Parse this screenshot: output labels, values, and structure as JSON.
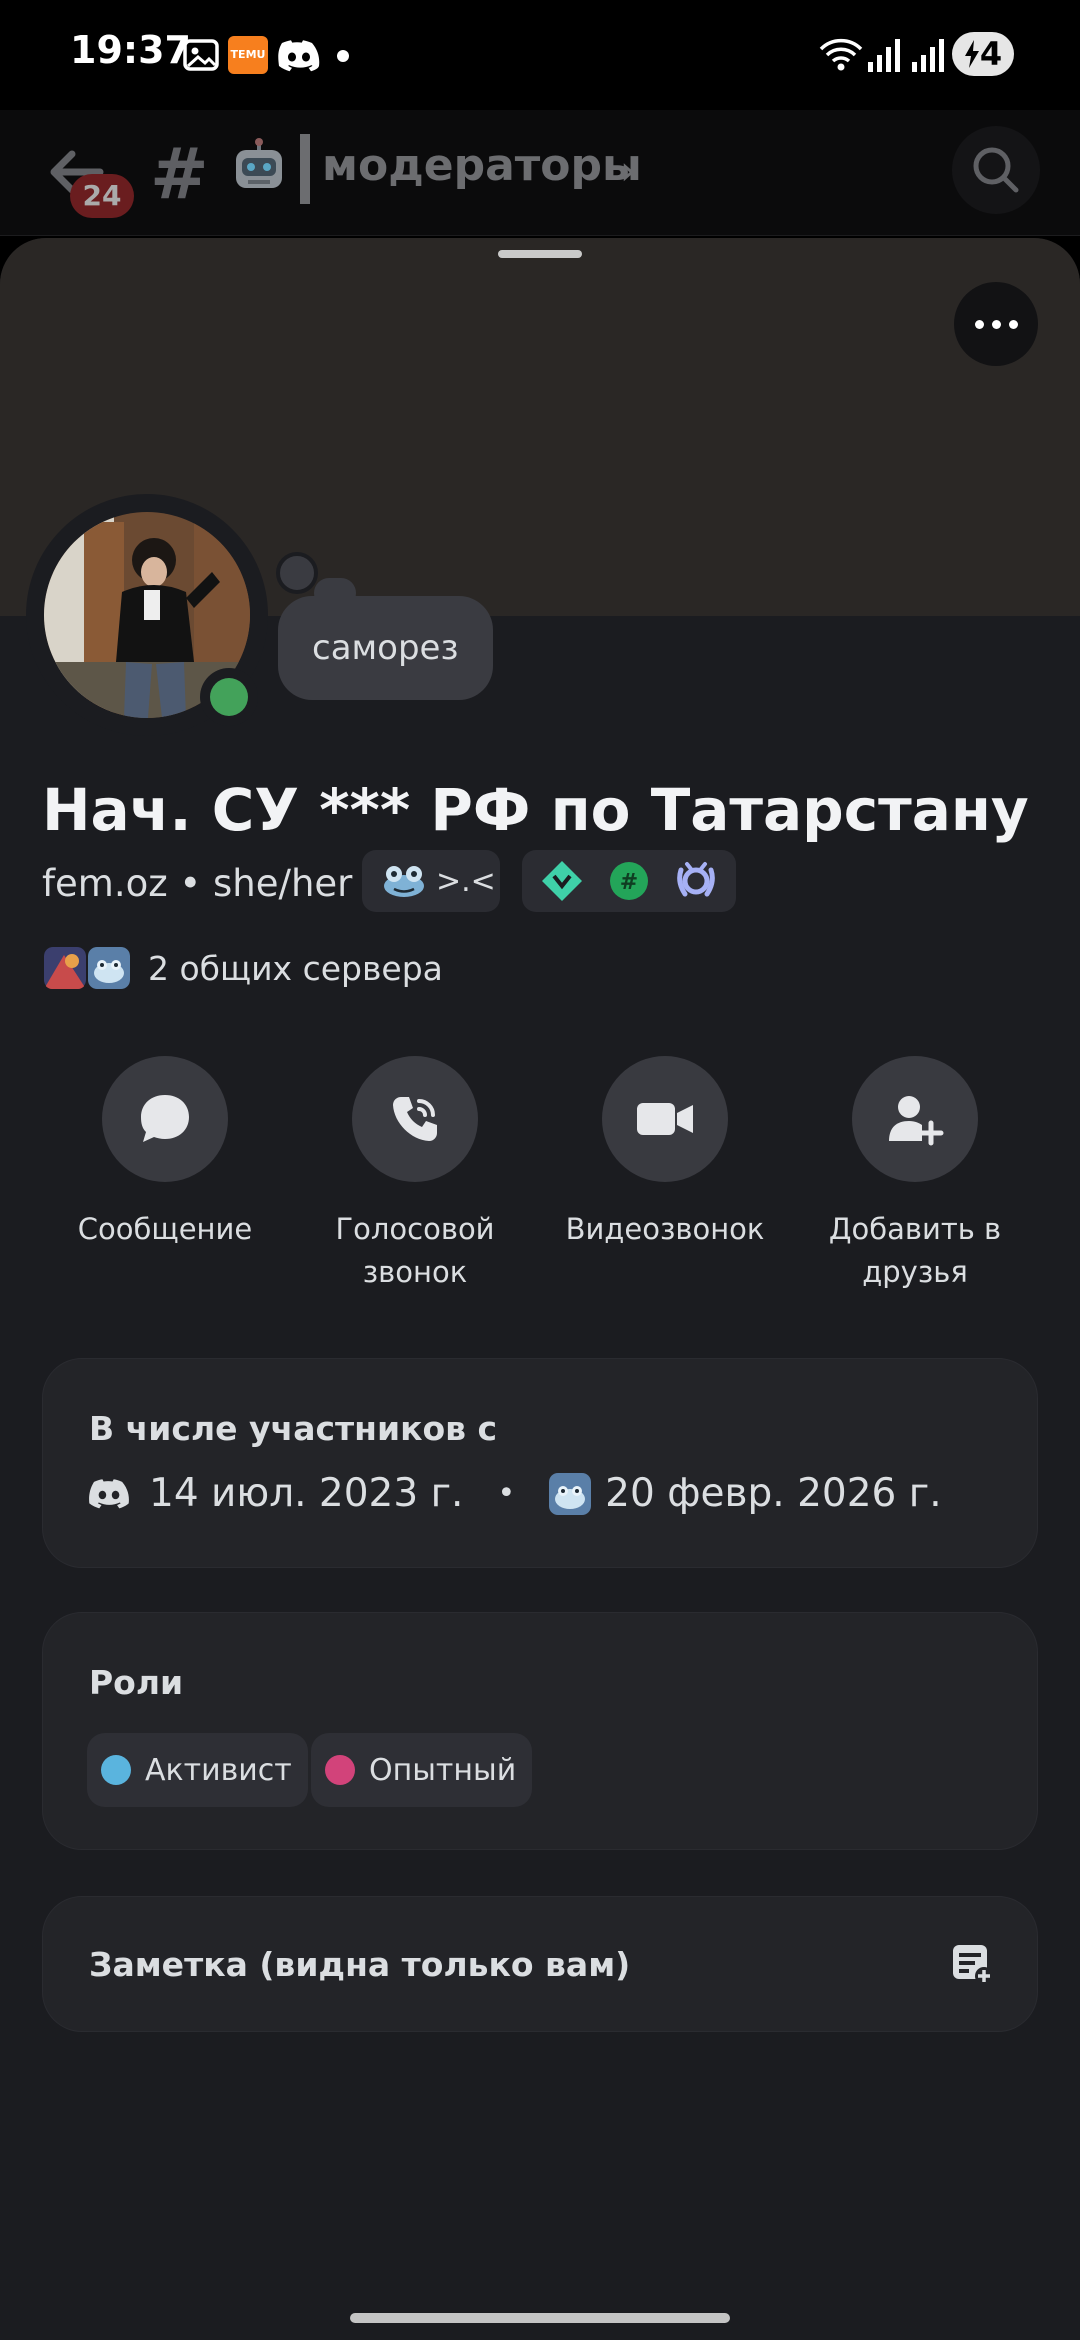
{
  "status_bar": {
    "time": "19:37",
    "temu_label": "TEMU",
    "battery": "4"
  },
  "channel_header": {
    "unread_badge": "24",
    "channel_name": "модераторы"
  },
  "profile": {
    "thought_bubble": "саморез",
    "display_name": "Нач. СУ *** РФ по Татарстану",
    "username": "fem.oz",
    "separator": "•",
    "pronouns": "she/her",
    "tag_text": ">.<",
    "mutual_servers": "2 общих сервера"
  },
  "actions": [
    {
      "label": "Сообщение",
      "icon": "chat-bubble-icon"
    },
    {
      "label": "Голосовой звонок",
      "icon": "phone-call-icon"
    },
    {
      "label": "Видеозвонок",
      "icon": "video-camera-icon"
    },
    {
      "label": "Добавить в друзья",
      "icon": "add-friend-icon"
    }
  ],
  "member_since": {
    "title": "В числе участников с",
    "discord_date": "14 июл. 2023 г.",
    "separator": "•",
    "server_date": "20 февр. 2026 г."
  },
  "roles": {
    "title": "Роли",
    "items": [
      {
        "name": "Активист",
        "color": "#5ab4de"
      },
      {
        "name": "Опытный",
        "color": "#d2437a"
      }
    ]
  },
  "note": {
    "title": "Заметка (видна только вам)"
  },
  "colors": {
    "online": "#43a25a",
    "background": "#1b1c20",
    "card": "#232428"
  }
}
